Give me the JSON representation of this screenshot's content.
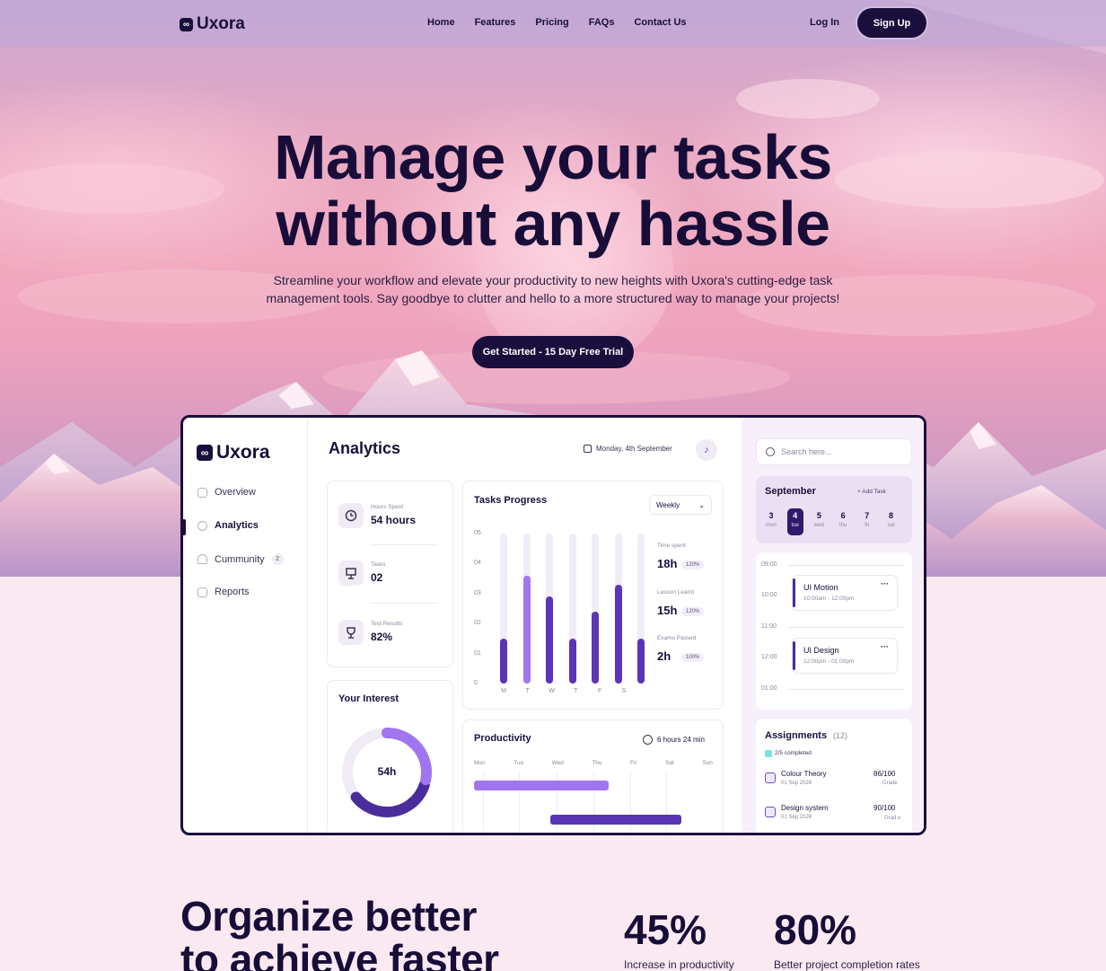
{
  "nav": {
    "brand": "Uxora",
    "links": [
      "Home",
      "Features",
      "Pricing",
      "FAQs",
      "Contact Us"
    ],
    "login": "Log In",
    "signup": "Sign Up"
  },
  "hero": {
    "title_line1": "Manage your tasks",
    "title_line2": "without any hassle",
    "subtitle_line1": "Streamline your workflow and elevate your productivity to new heights with Uxora's cutting-edge task",
    "subtitle_line2": "management tools. Say goodbye to clutter and hello to a more structured way to manage your projects!",
    "cta": "Get Started - 15 Day Free Trial"
  },
  "dashboard": {
    "brand": "Uxora",
    "sidebar": [
      {
        "label": "Overview"
      },
      {
        "label": "Analytics"
      },
      {
        "label": "Cummunity",
        "badge": "2"
      },
      {
        "label": "Reports"
      }
    ],
    "title": "Analytics",
    "date": "Monday, 4th September",
    "stats": [
      {
        "label": "Hours Spent",
        "value": "54 hours"
      },
      {
        "label": "Tasks",
        "value": "02"
      },
      {
        "label": "Test Results",
        "value": "82%"
      }
    ],
    "interest": {
      "title": "Your Interest",
      "center": "54h",
      "fraction": 0.62
    },
    "tasks_progress": {
      "title": "Tasks Progress",
      "period": "Weekly",
      "y_ticks": [
        "05",
        "04",
        "03",
        "02",
        "01",
        "0"
      ],
      "days": [
        "M",
        "T",
        "W",
        "T",
        "F",
        "S"
      ],
      "values": [
        1.5,
        3.6,
        2.9,
        1.5,
        2.4,
        3.3,
        1.5
      ],
      "metrics": [
        {
          "label": "Time spent",
          "value": "18h",
          "pill": "120%"
        },
        {
          "label": "Lesson Learnt",
          "value": "15h",
          "pill": "120%"
        },
        {
          "label": "Exams Passed",
          "value": "2h",
          "pill": "100%"
        }
      ]
    },
    "productivity": {
      "title": "Productivity",
      "duration": "6 hours 24 min",
      "days": [
        "Mon",
        "Tue",
        "Wed",
        "Thu",
        "Fri",
        "Sat",
        "Sun"
      ]
    },
    "search_placeholder": "Search here...",
    "calendar": {
      "month": "September",
      "add_task": "+ Add Task",
      "days": [
        {
          "num": "3",
          "name": "mon"
        },
        {
          "num": "4",
          "name": "tue"
        },
        {
          "num": "5",
          "name": "wed"
        },
        {
          "num": "6",
          "name": "thu"
        },
        {
          "num": "7",
          "name": "fri"
        },
        {
          "num": "8",
          "name": "sat"
        }
      ],
      "times": [
        "09:00",
        "10:00",
        "11:00",
        "12:00",
        "01:00"
      ],
      "events": [
        {
          "title": "UI Motion",
          "time": "10:00am - 12:00pm"
        },
        {
          "title": "UI Design",
          "time": "12:00pm - 01:00pm"
        }
      ]
    },
    "assignments": {
      "title": "Assignments",
      "count": "(12)",
      "completed": "2/5 completed",
      "items": [
        {
          "title": "Colour Theory",
          "date": "01 Sep 2026",
          "score": "86/100",
          "grade": "Grade"
        },
        {
          "title": "Design system",
          "date": "01 Sep 2026",
          "score": "90/100",
          "grade": "Grad e"
        }
      ]
    }
  },
  "lower": {
    "title_line1": "Organize better",
    "title_line2": "to achieve faster",
    "stats": [
      {
        "value": "45%",
        "caption": "Increase in productivity"
      },
      {
        "value": "80%",
        "caption": "Better project completion rates"
      }
    ]
  },
  "colors": {
    "navy": "#1a0f3c",
    "purple": "#6a3fc6",
    "light_purple": "#a174f0"
  }
}
